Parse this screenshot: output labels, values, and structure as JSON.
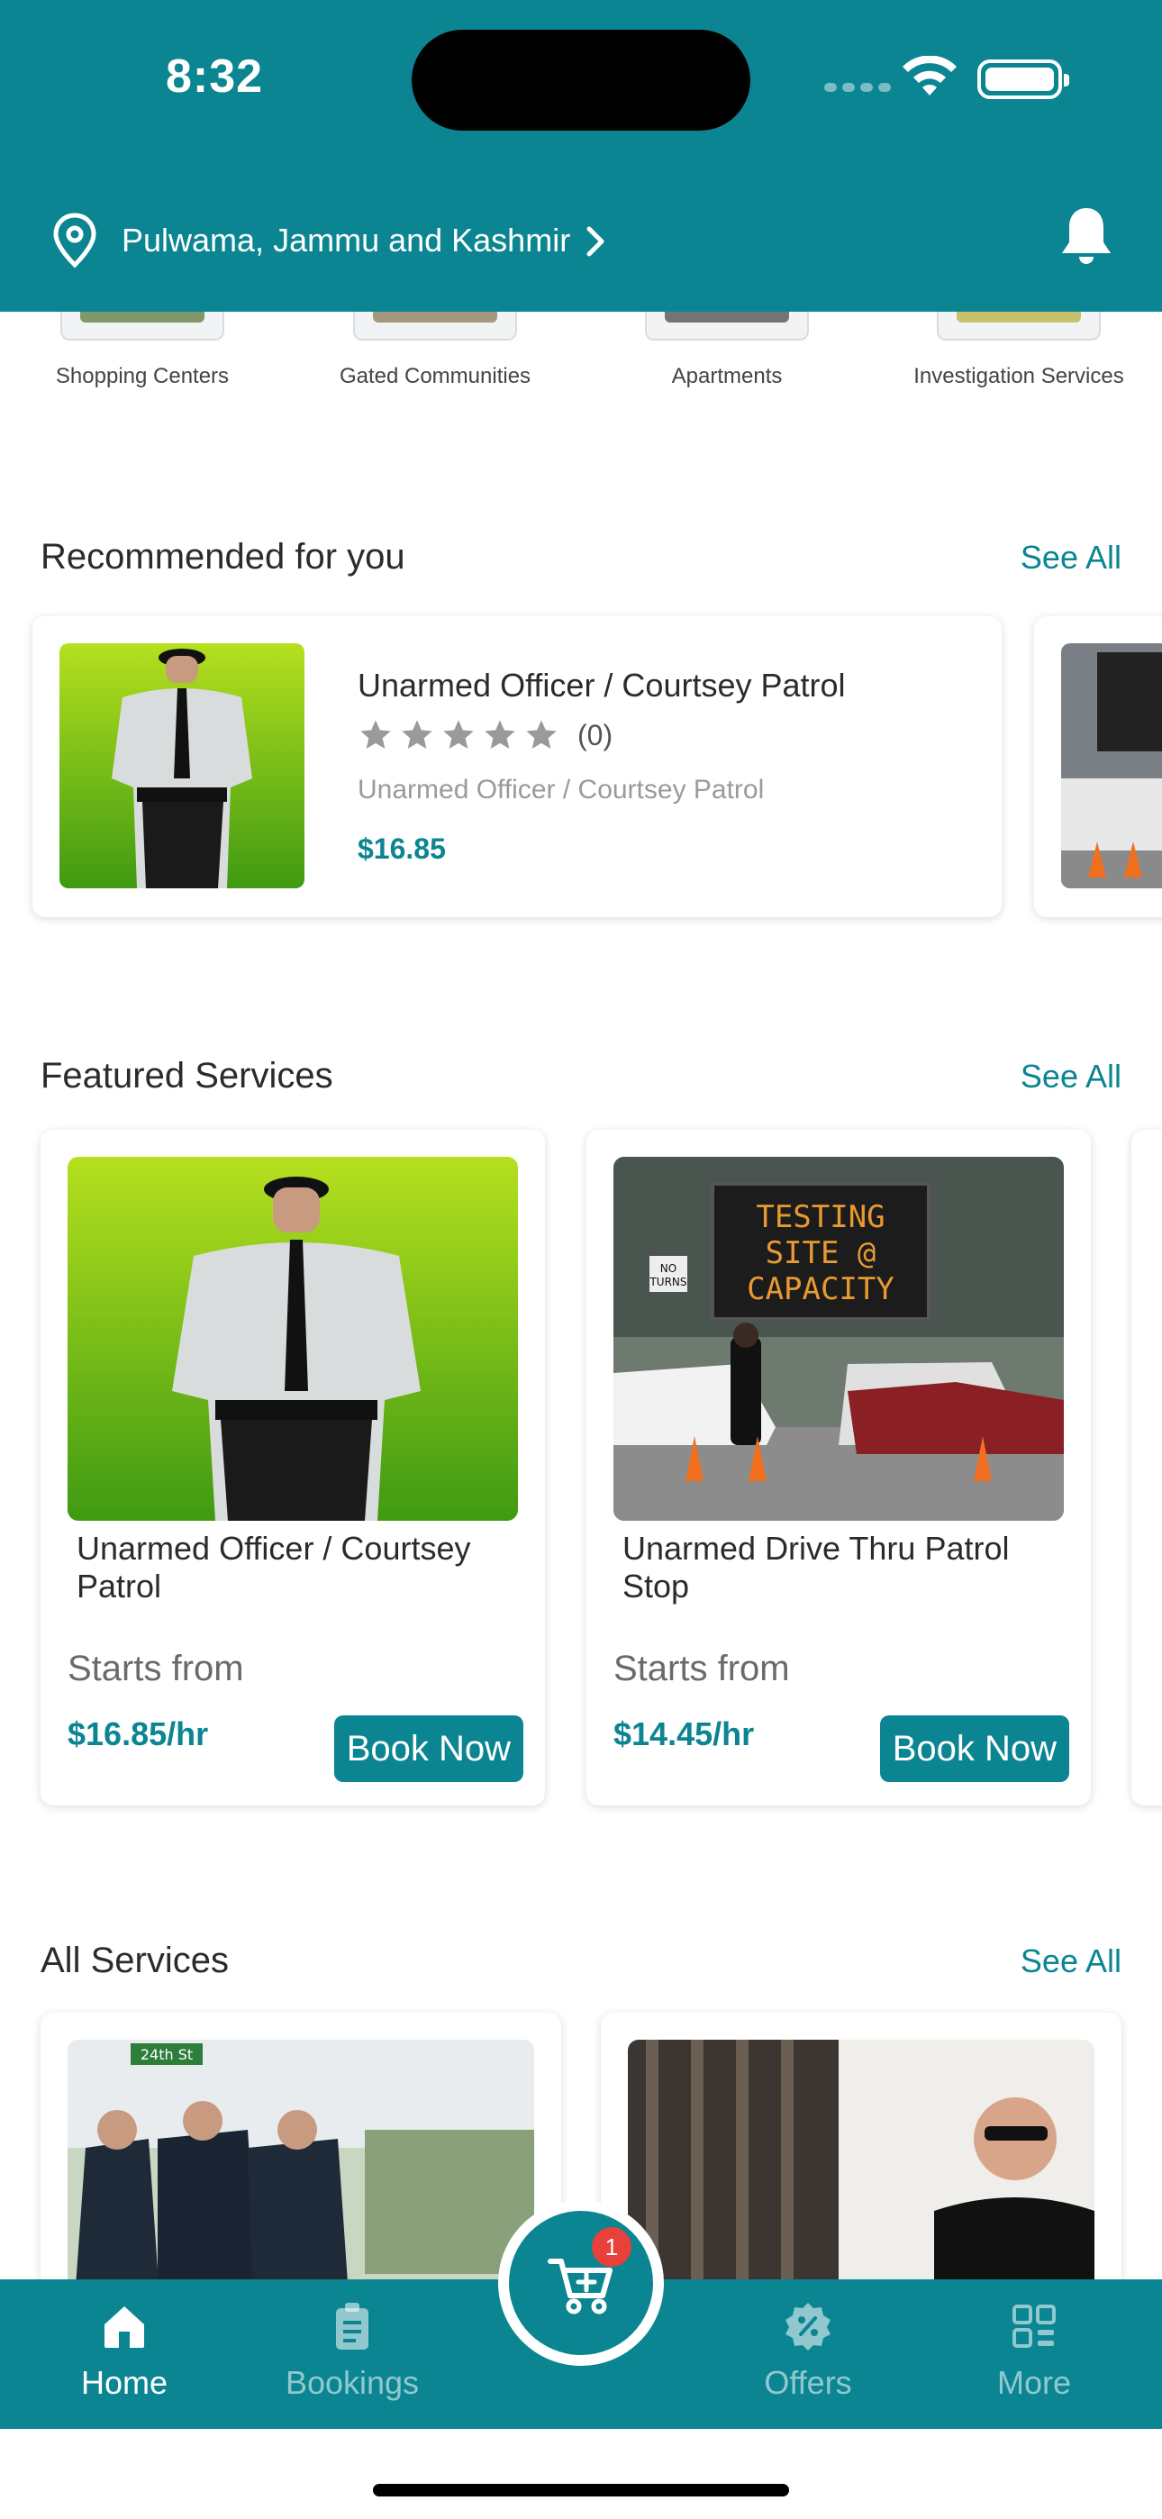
{
  "status_bar": {
    "time": "8:32"
  },
  "header": {
    "location": "Pulwama, Jammu and Kashmir"
  },
  "categories": [
    {
      "label": "Shopping Centers"
    },
    {
      "label": "Gated Communities"
    },
    {
      "label": "Apartments"
    },
    {
      "label": "Investigation Services"
    }
  ],
  "recommended": {
    "title": "Recommended for you",
    "see_all": "See All",
    "items": [
      {
        "name": "Unarmed Officer / Courtsey Patrol",
        "rating_count": "(0)",
        "subtitle": "Unarmed Officer / Courtsey Patrol",
        "price": "$16.85"
      }
    ]
  },
  "featured": {
    "title": "Featured Services",
    "see_all": "See All",
    "items": [
      {
        "name": "Unarmed Officer / Courtsey Patrol",
        "starts_label": "Starts from",
        "price": "$16.85/hr",
        "button": "Book Now"
      },
      {
        "name": "Unarmed Drive Thru Patrol Stop",
        "starts_label": "Starts from",
        "price": "$14.45/hr",
        "button": "Book Now"
      }
    ],
    "sign_text": "TESTING SITE @ CAPACITY",
    "no_turns": "NO TURNS"
  },
  "all_services": {
    "title": "All Services",
    "see_all": "See All",
    "street_sign": "24th St"
  },
  "tabbar": {
    "cart_count": "1",
    "tabs": [
      {
        "label": "Home",
        "active": true
      },
      {
        "label": "Bookings",
        "active": false
      },
      {
        "label": "Offers",
        "active": false
      },
      {
        "label": "More",
        "active": false
      }
    ]
  },
  "colors": {
    "primary": "#0b8592",
    "badge": "#e8403a",
    "price": "#0b8592"
  }
}
